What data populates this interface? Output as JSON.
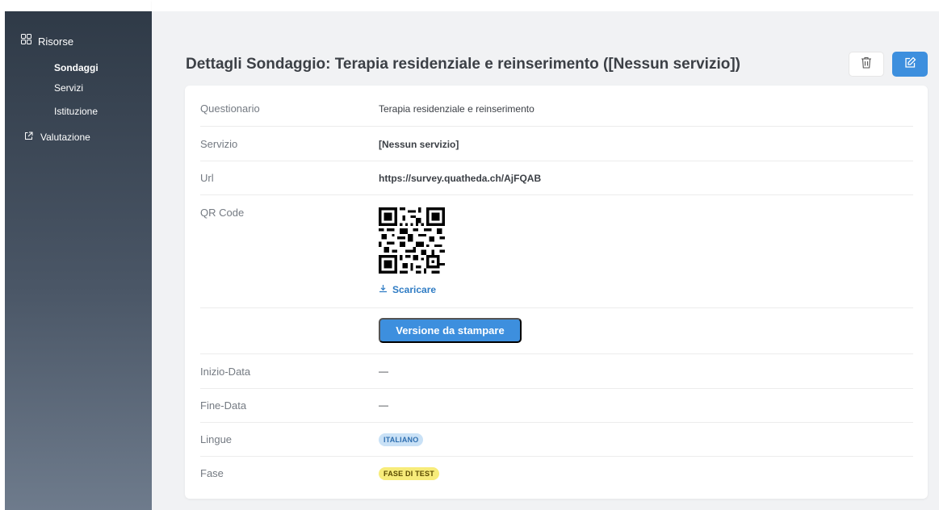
{
  "sidebar": {
    "group_label": "Risorse",
    "items": [
      {
        "label": "Sondaggi",
        "active": true
      },
      {
        "label": "Servizi",
        "active": false
      },
      {
        "label": "Istituzione",
        "active": false
      }
    ],
    "external_label": "Valutazione"
  },
  "page": {
    "title": "Dettagli Sondaggio: Terapia residenziale e reinserimento ([Nessun servizio])"
  },
  "actions": {
    "delete_icon": "trash-icon",
    "edit_icon": "edit-icon"
  },
  "details": {
    "questionario_label": "Questionario",
    "questionario_value": "Terapia residenziale e reinserimento",
    "servizio_label": "Servizio",
    "servizio_value": "[Nessun servizio]",
    "url_label": "Url",
    "url_value": "https://survey.quatheda.ch/AjFQAB",
    "qr_label": "QR Code",
    "download_label": "Scaricare",
    "print_label": "Versione da stampare",
    "start_label": "Inizio-Data",
    "start_value": "—",
    "end_label": "Fine-Data",
    "end_value": "—",
    "lang_label": "Lingue",
    "lang_value": "ITALIANO",
    "phase_label": "Fase",
    "phase_value": "FASE DI TEST"
  },
  "colors": {
    "accent": "#3d8fde",
    "link": "#2f7cc4",
    "sidebar_top": "#2f3a47",
    "badge_lang": "#c9e1f6",
    "badge_phase": "#f7ec7a"
  }
}
